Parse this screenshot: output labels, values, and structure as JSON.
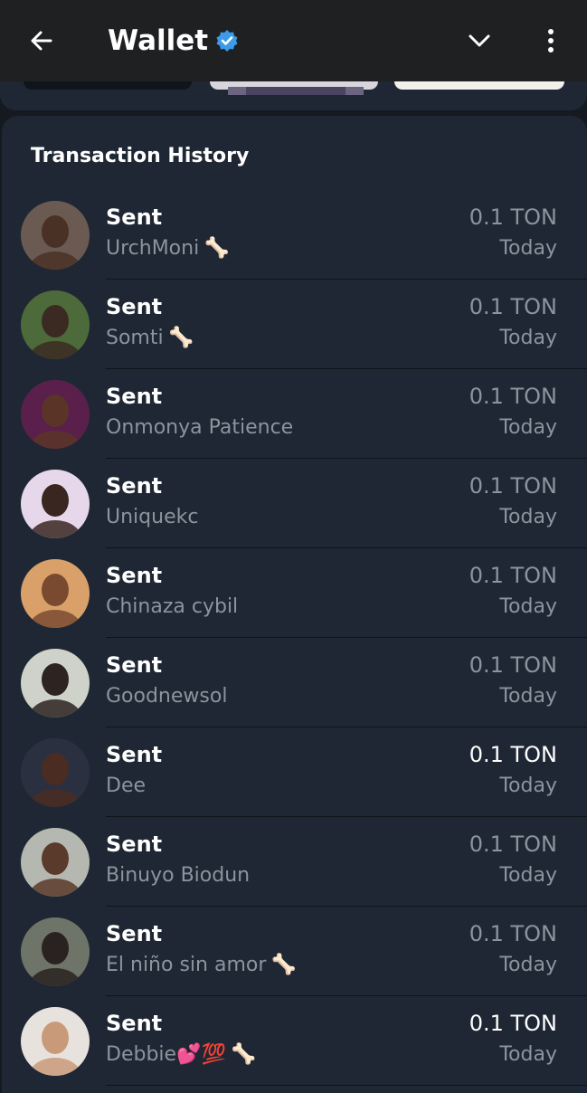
{
  "header": {
    "title": "Wallet",
    "icons": {
      "back": "arrow-left-icon",
      "verified": "verified-badge-icon",
      "chevron": "chevron-down-icon",
      "menu": "more-vertical-icon"
    }
  },
  "history": {
    "title": "Transaction History",
    "items": [
      {
        "type": "Sent",
        "name": "UrchMoni",
        "emoji": "🦴",
        "amount": "0.1 TON",
        "date": "Today",
        "bright": false,
        "avatar_bg": "#6a5a52",
        "avatar_skin": "#4a3126"
      },
      {
        "type": "Sent",
        "name": "Somti",
        "emoji": "🦴",
        "amount": "0.1 TON",
        "date": "Today",
        "bright": false,
        "avatar_bg": "#4d6a3a",
        "avatar_skin": "#3b2a22"
      },
      {
        "type": "Sent",
        "name": "Onmonya Patience",
        "emoji": "",
        "amount": "0.1 TON",
        "date": "Today",
        "bright": false,
        "avatar_bg": "#5a1f4a",
        "avatar_skin": "#5a3527"
      },
      {
        "type": "Sent",
        "name": "Uniquekc",
        "emoji": "",
        "amount": "0.1 TON",
        "date": "Today",
        "bright": false,
        "avatar_bg": "#e6d8ea",
        "avatar_skin": "#3a2620"
      },
      {
        "type": "Sent",
        "name": "Chinaza cybil",
        "emoji": "",
        "amount": "0.1 TON",
        "date": "Today",
        "bright": false,
        "avatar_bg": "#d9a06a",
        "avatar_skin": "#7a4a30"
      },
      {
        "type": "Sent",
        "name": "Goodnewsol",
        "emoji": "",
        "amount": "0.1 TON",
        "date": "Today",
        "bright": false,
        "avatar_bg": "#cfd2c8",
        "avatar_skin": "#2d2320"
      },
      {
        "type": "Sent",
        "name": "Dee",
        "emoji": "",
        "amount": "0.1 TON",
        "date": "Today",
        "bright": true,
        "avatar_bg": "#2a3040",
        "avatar_skin": "#4a2c22"
      },
      {
        "type": "Sent",
        "name": "Binuyo Biodun",
        "emoji": "",
        "amount": "0.1 TON",
        "date": "Today",
        "bright": false,
        "avatar_bg": "#b5b8b0",
        "avatar_skin": "#5a3a2a"
      },
      {
        "type": "Sent",
        "name": "El niño sin amor",
        "emoji": "🦴",
        "amount": "0.1 TON",
        "date": "Today",
        "bright": false,
        "avatar_bg": "#6e7468",
        "avatar_skin": "#2a2220"
      },
      {
        "type": "Sent",
        "name": "Debbie💕💯",
        "emoji": "🦴",
        "amount": "0.1 TON",
        "date": "Today",
        "bright": true,
        "avatar_bg": "#e8e2de",
        "avatar_skin": "#c99a7a"
      }
    ]
  },
  "colors": {
    "background": "#151a21",
    "card": "#1e2733",
    "header": "#1f2022",
    "muted": "#8c949d",
    "verified": "#3d9be9"
  }
}
